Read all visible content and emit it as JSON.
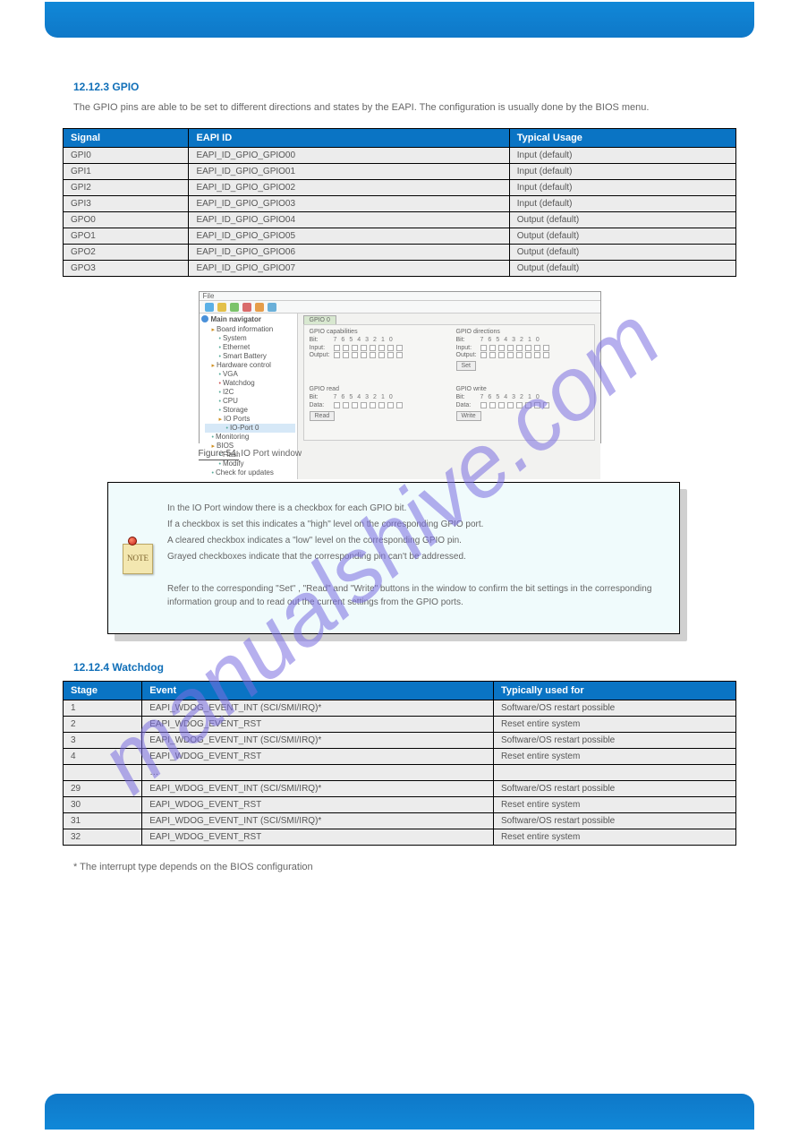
{
  "section1": {
    "heading": "12.12.3 GPIO",
    "intro": "The GPIO pins are able to be set to different directions and states by the EAPI. The configuration is usually done by the BIOS menu.",
    "tableHeaders": [
      "Signal",
      "EAPI ID",
      "Typical Usage"
    ],
    "rows": [
      [
        "GPI0",
        "EAPI_ID_GPIO_GPIO00",
        "Input (default)"
      ],
      [
        "GPI1",
        "EAPI_ID_GPIO_GPIO01",
        "Input (default)"
      ],
      [
        "GPI2",
        "EAPI_ID_GPIO_GPIO02",
        "Input (default)"
      ],
      [
        "GPI3",
        "EAPI_ID_GPIO_GPIO03",
        "Input (default)"
      ],
      [
        "GPO0",
        "EAPI_ID_GPIO_GPIO04",
        "Output (default)"
      ],
      [
        "GPO1",
        "EAPI_ID_GPIO_GPIO05",
        "Output (default)"
      ],
      [
        "GPO2",
        "EAPI_ID_GPIO_GPIO06",
        "Output (default)"
      ],
      [
        "GPO3",
        "EAPI_ID_GPIO_GPIO07",
        "Output (default)"
      ]
    ]
  },
  "figure": {
    "menubar": "File",
    "navTitle": "Main navigator",
    "tree": {
      "boardInfo": "Board information",
      "system": "System",
      "ethernet": "Ethernet",
      "smartBattery": "Smart Battery",
      "hwControl": "Hardware control",
      "vga": "VGA",
      "watchdog": "Watchdog",
      "i2c": "I2C",
      "cpu": "CPU",
      "storage": "Storage",
      "ioPorts": "IO Ports",
      "ioPort0": "IO-Port 0",
      "monitoring": "Monitoring",
      "bios": "BIOS",
      "flash": "Flash",
      "modify": "Modify",
      "updates": "Check for updates"
    },
    "tabLabel": "GPIO 0",
    "groups": {
      "cap": "GPIO capabilities",
      "dir": "GPIO directions",
      "read": "GPIO read",
      "write": "GPIO write"
    },
    "labels": {
      "bit": "Bit:",
      "input": "Input:",
      "output": "Output:",
      "data": "Data:",
      "btnSet": "Set",
      "btnRead": "Read",
      "btnWrite": "Write"
    },
    "bits": [
      "7",
      "6",
      "5",
      "4",
      "3",
      "2",
      "1",
      "0"
    ],
    "captionPrefix": "Figure 54:",
    "captionText": " IO Port window"
  },
  "note": {
    "iconText": "NOTE",
    "lines": [
      "In the IO Port window there is a checkbox for each GPIO bit.",
      "If a checkbox is set this indicates a \"high\" level on the corresponding GPIO port.",
      "A cleared checkbox indicates a \"low\" level on the corresponding GPIO pin.",
      "Grayed checkboxes indicate that the corresponding pin can't be addressed.",
      "",
      "Refer to the corresponding \"Set\" , \"Read\" and \"Write\" buttons in the window to confirm the bit settings in the corresponding information group and to read out the current settings from the GPIO ports."
    ]
  },
  "section2": {
    "heading": "12.12.4 Watchdog",
    "tableHeaders": [
      "Stage",
      "Event",
      "Typically used for"
    ],
    "rows": [
      [
        "1",
        "EAPI_WDOG_EVENT_INT (SCI/SMI/IRQ)*",
        "Software/OS restart possible"
      ],
      [
        "2",
        "EAPI_WDOG_EVENT_RST",
        "Reset entire system"
      ],
      [
        "3",
        "EAPI_WDOG_EVENT_INT (SCI/SMI/IRQ)*",
        "Software/OS restart possible"
      ],
      [
        "4",
        "EAPI_WDOG_EVENT_RST",
        "Reset entire system"
      ],
      [
        "",
        "…",
        ""
      ],
      [
        "29",
        "EAPI_WDOG_EVENT_INT (SCI/SMI/IRQ)*",
        "Software/OS restart possible"
      ],
      [
        "30",
        "EAPI_WDOG_EVENT_RST",
        "Reset entire system"
      ],
      [
        "31",
        "EAPI_WDOG_EVENT_INT (SCI/SMI/IRQ)*",
        "Software/OS restart possible"
      ],
      [
        "32",
        "EAPI_WDOG_EVENT_RST",
        "Reset entire system"
      ]
    ],
    "footnote": "* The interrupt type depends on the BIOS configuration"
  },
  "watermarkText": "manualshive.com"
}
